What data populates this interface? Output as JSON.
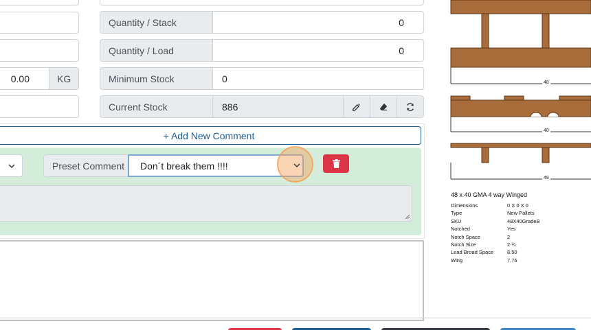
{
  "form": {
    "weight_value": "0.00",
    "weight_unit": "KG",
    "qty_stack_label": "Quantity / Stack",
    "qty_stack_value": "0",
    "qty_load_label": "Quantity / Load",
    "qty_load_value": "0",
    "min_stock_label": "Minimum Stock",
    "min_stock_value": "0",
    "current_stock_label": "Current Stock",
    "current_stock_value": "886"
  },
  "comments": {
    "add_label": "+ Add New Comment",
    "preset_label": "Preset Comment",
    "preset_selected": "Don´t break them !!!!"
  },
  "diagram": {
    "dim_label": "48",
    "title": "48 x 40 GMA 4 way Winged",
    "specs": [
      {
        "key": "Dimensions",
        "value": "0 X 0 X 0"
      },
      {
        "key": "Type",
        "value": "New Pallets"
      },
      {
        "key": "SKU",
        "value": "48X40GradeB"
      },
      {
        "key": "Notched",
        "value": "Yes"
      },
      {
        "key": "Notch Space",
        "value": "2"
      },
      {
        "key": "Notch Size",
        "value": "2 ¾"
      },
      {
        "key": "Lead Broad Space",
        "value": "8.50"
      },
      {
        "key": "Wing",
        "value": "7.75"
      }
    ]
  },
  "colors": {
    "wood": "#a86d3a",
    "wood_dark": "#7a4a22",
    "panel_green": "#d4edda",
    "danger": "#dc3545",
    "primary": "#1e5d8f",
    "cursor_highlight": "#f5a15a"
  }
}
